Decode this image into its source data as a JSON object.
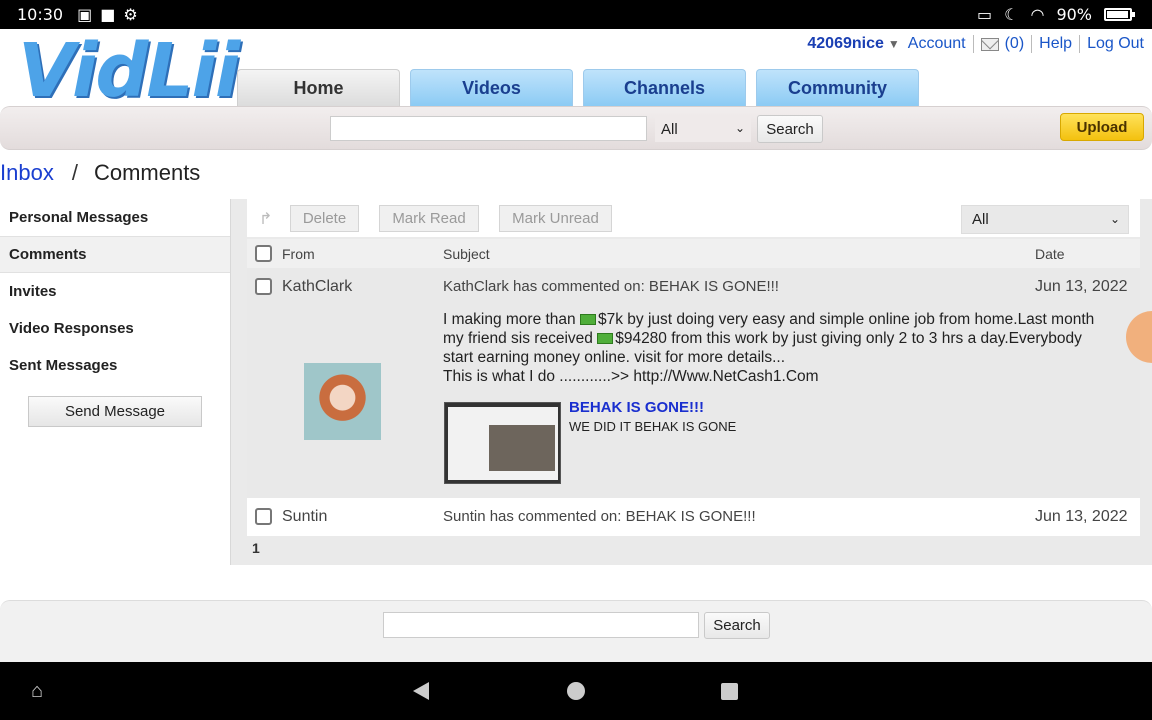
{
  "status_bar": {
    "time": "10:30",
    "battery": "90%"
  },
  "header": {
    "logo": "VidLii",
    "username": "42069nice",
    "links": {
      "account": "Account",
      "mail_count": "(0)",
      "help": "Help",
      "logout": "Log Out"
    },
    "tabs": [
      "Home",
      "Videos",
      "Channels",
      "Community"
    ],
    "search": {
      "placeholder": "",
      "filter": "All",
      "button": "Search"
    },
    "upload": "Upload"
  },
  "breadcrumb": {
    "parent": "Inbox",
    "separator": "/",
    "current": "Comments"
  },
  "sidebar": {
    "items": [
      "Personal Messages",
      "Comments",
      "Invites",
      "Video Responses",
      "Sent Messages"
    ],
    "active": "Comments",
    "send_button": "Send Message"
  },
  "toolbar": {
    "delete": "Delete",
    "mark_read": "Mark Read",
    "mark_unread": "Mark Unread",
    "filter": "All"
  },
  "table": {
    "headers": {
      "from": "From",
      "subject": "Subject",
      "date": "Date"
    },
    "rows": [
      {
        "from": "KathClark",
        "subject": "KathClark has commented on: BEHAK IS GONE!!!",
        "date": "Jun 13, 2022",
        "body": {
          "line1a": "I making more than ",
          "line1b": "$7k by just doing very easy and simple online job from home.Last month",
          "line2a": "my friend sis received ",
          "line2b": "$94280 from this work by just giving only 2 to 3 hrs a day.Everybody",
          "line3": "start earning money online. visit for more details...",
          "line4": "This is what I do ............>> http://Www.NetCash1.Com"
        },
        "video": {
          "title": "BEHAK IS GONE!!!",
          "description": "WE DID IT BEHAK IS GONE"
        }
      },
      {
        "from": "Suntin",
        "subject": "Suntin has commented on: BEHAK IS GONE!!!",
        "date": "Jun 13, 2022"
      }
    ]
  },
  "pagination": {
    "current": "1"
  },
  "footer": {
    "search_button": "Search"
  }
}
